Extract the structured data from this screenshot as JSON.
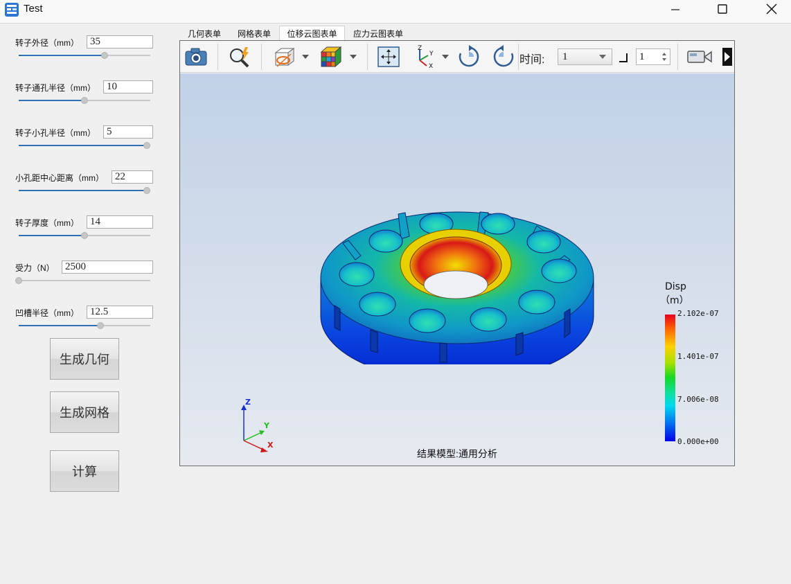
{
  "window": {
    "title": "Test"
  },
  "params": [
    {
      "label": "转子外径（mm）",
      "value": "35",
      "slider": 0.66
    },
    {
      "label": "转子通孔半径（mm）",
      "value": "10",
      "slider": 0.5
    },
    {
      "label": "转子小孔半径（mm）",
      "value": "5",
      "slider": 1.0
    },
    {
      "label": "小孔距中心距离（mm）",
      "value": "22",
      "slider": 1.0
    },
    {
      "label": "转子厚度（mm）",
      "value": "14",
      "slider": 0.5
    },
    {
      "label": "受力（N）",
      "value": "2500",
      "slider": 0.0
    },
    {
      "label": "凹槽半径（mm）",
      "value": "12.5",
      "slider": 0.63
    }
  ],
  "buttons": {
    "geometry": "生成几何",
    "mesh": "生成网格",
    "compute": "计算"
  },
  "tabs": [
    "几何表单",
    "网格表单",
    "位移云图表单",
    "应力云图表单"
  ],
  "active_tab": "位移云图表单",
  "toolbar": {
    "time_label": "时间:",
    "time_value": "1",
    "step_value": "1"
  },
  "legend": {
    "title_line1": "Disp",
    "title_line2": "（m）",
    "ticks": [
      "2.102e-07",
      "1.401e-07",
      "7.006e-08",
      "0.000e+00"
    ]
  },
  "axes": {
    "z": "Z",
    "y": "Y",
    "x": "X"
  },
  "caption": "结果模型:通用分析",
  "colors": {
    "accent": "#2d6fb4",
    "max": "#e8001e",
    "min": "#0000e8"
  }
}
